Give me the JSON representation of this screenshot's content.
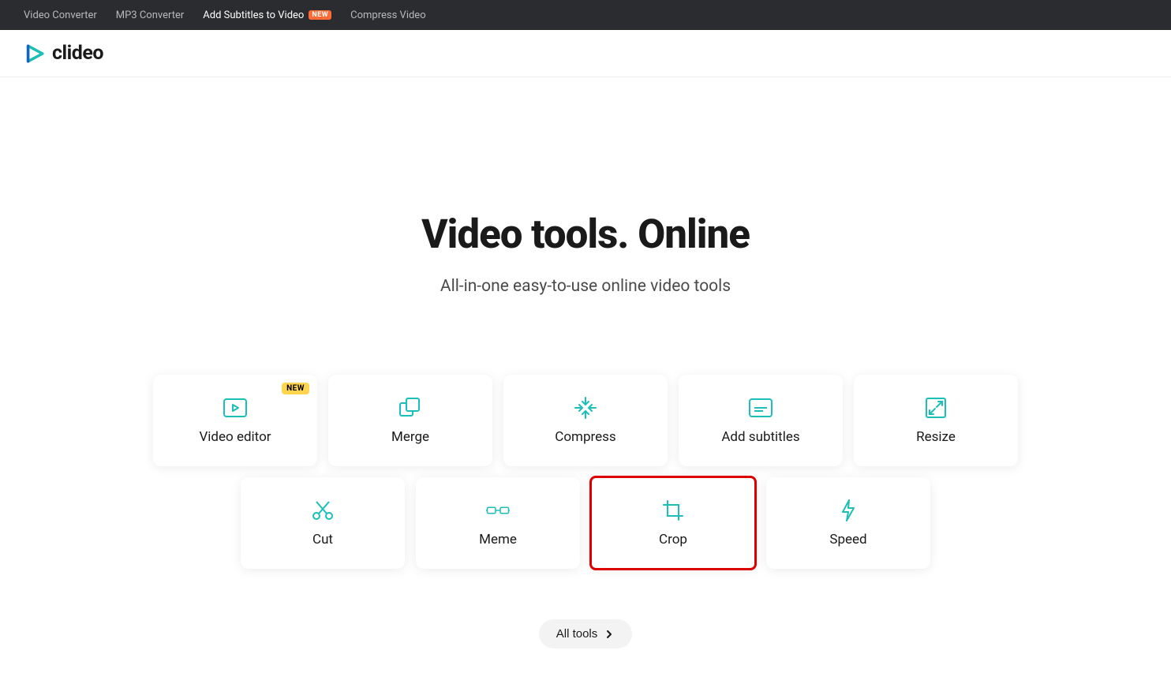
{
  "topNav": {
    "items": [
      {
        "label": "Video Converter",
        "active": false,
        "badge": null
      },
      {
        "label": "MP3 Converter",
        "active": false,
        "badge": null
      },
      {
        "label": "Add Subtitles to Video",
        "active": true,
        "badge": "NEW"
      },
      {
        "label": "Compress Video",
        "active": false,
        "badge": null
      }
    ]
  },
  "brand": {
    "name": "clideo"
  },
  "hero": {
    "title": "Video tools. Online",
    "subtitle": "All-in-one easy-to-use online video tools"
  },
  "tools": {
    "row1": [
      {
        "label": "Video editor",
        "icon": "play-icon",
        "badge": "NEW",
        "highlight": false
      },
      {
        "label": "Merge",
        "icon": "merge-icon",
        "badge": null,
        "highlight": false
      },
      {
        "label": "Compress",
        "icon": "compress-icon",
        "badge": null,
        "highlight": false
      },
      {
        "label": "Add subtitles",
        "icon": "subtitles-icon",
        "badge": null,
        "highlight": false
      },
      {
        "label": "Resize",
        "icon": "resize-icon",
        "badge": null,
        "highlight": false
      }
    ],
    "row2": [
      {
        "label": "Cut",
        "icon": "cut-icon",
        "badge": null,
        "highlight": false
      },
      {
        "label": "Meme",
        "icon": "meme-icon",
        "badge": null,
        "highlight": false
      },
      {
        "label": "Crop",
        "icon": "crop-icon",
        "badge": null,
        "highlight": true
      },
      {
        "label": "Speed",
        "icon": "speed-icon",
        "badge": null,
        "highlight": false
      }
    ]
  },
  "allToolsButton": {
    "label": "All tools"
  },
  "colors": {
    "accent": "#1bbfb8"
  }
}
